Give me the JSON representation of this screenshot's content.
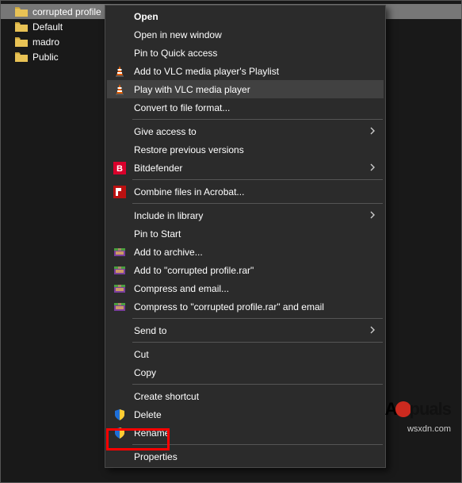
{
  "file_list": {
    "items": [
      {
        "name": "corrupted profile",
        "selected": true
      },
      {
        "name": "Default",
        "selected": false
      },
      {
        "name": "madro",
        "selected": false
      },
      {
        "name": "Public",
        "selected": false
      }
    ]
  },
  "context_menu": {
    "groups": [
      [
        {
          "label": "Open",
          "bold": true,
          "icon": null,
          "submenu": false
        },
        {
          "label": "Open in new window",
          "icon": null,
          "submenu": false
        },
        {
          "label": "Pin to Quick access",
          "icon": null,
          "submenu": false
        },
        {
          "label": "Add to VLC media player's Playlist",
          "icon": "vlc",
          "submenu": false
        },
        {
          "label": "Play with VLC media player",
          "icon": "vlc",
          "submenu": false,
          "highlight": true
        },
        {
          "label": "Convert to file format...",
          "icon": null,
          "submenu": false
        }
      ],
      [
        {
          "label": "Give access to",
          "icon": null,
          "submenu": true
        },
        {
          "label": "Restore previous versions",
          "icon": null,
          "submenu": false
        },
        {
          "label": "Bitdefender",
          "icon": "bitdefender",
          "submenu": true
        }
      ],
      [
        {
          "label": "Combine files in Acrobat...",
          "icon": "acrobat",
          "submenu": false
        }
      ],
      [
        {
          "label": "Include in library",
          "icon": null,
          "submenu": true
        },
        {
          "label": "Pin to Start",
          "icon": null,
          "submenu": false
        },
        {
          "label": "Add to archive...",
          "icon": "winrar",
          "submenu": false
        },
        {
          "label": "Add to \"corrupted profile.rar\"",
          "icon": "winrar",
          "submenu": false
        },
        {
          "label": "Compress and email...",
          "icon": "winrar",
          "submenu": false
        },
        {
          "label": "Compress to \"corrupted profile.rar\" and email",
          "icon": "winrar",
          "submenu": false
        }
      ],
      [
        {
          "label": "Send to",
          "icon": null,
          "submenu": true
        }
      ],
      [
        {
          "label": "Cut",
          "icon": null,
          "submenu": false
        },
        {
          "label": "Copy",
          "icon": null,
          "submenu": false
        }
      ],
      [
        {
          "label": "Create shortcut",
          "icon": null,
          "submenu": false
        },
        {
          "label": "Delete",
          "icon": "shield",
          "submenu": false,
          "boxed": true
        },
        {
          "label": "Rename",
          "icon": "shield",
          "submenu": false
        }
      ],
      [
        {
          "label": "Properties",
          "icon": null,
          "submenu": false
        }
      ]
    ]
  },
  "watermark": {
    "brand_a": "A",
    "brand_rest": "puals",
    "site": "wsxdn.com"
  }
}
